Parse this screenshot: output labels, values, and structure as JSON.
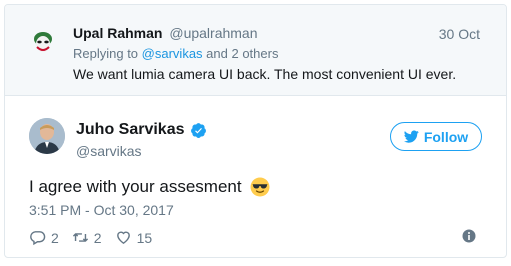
{
  "reply": {
    "name": "Upal Rahman",
    "handle": "@upalrahman",
    "date": "30 Oct",
    "replying_prefix": "Replying to",
    "replying_user": "@sarvikas",
    "replying_suffix": "and 2 others",
    "text": "We want lumia camera UI back. The most convenient UI ever.",
    "avatar_icon": "joker-avatar-icon"
  },
  "tweet": {
    "name": "Juho Sarvikas",
    "handle": "@sarvikas",
    "verified_icon": "verified-badge-icon",
    "follow_label": "Follow",
    "text": "I agree with your assesment",
    "emoji": "sunglasses-emoji-icon",
    "timestamp": "3:51 PM - Oct 30, 2017"
  },
  "actions": {
    "replies": "2",
    "retweets": "2",
    "likes": "15"
  },
  "colors": {
    "accent": "#1da1f2",
    "muted": "#657786",
    "border": "#e1e8ed"
  }
}
